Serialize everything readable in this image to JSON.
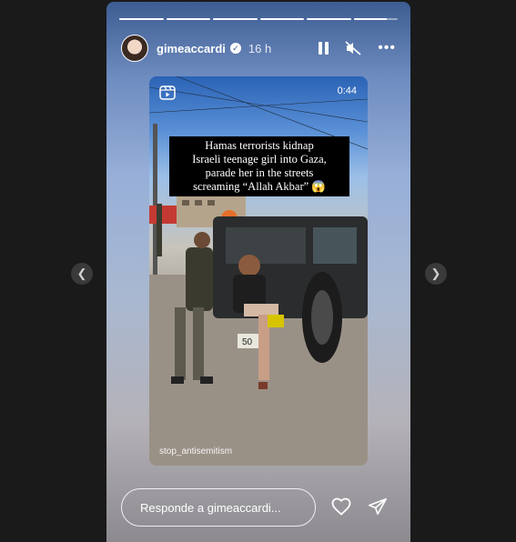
{
  "story": {
    "username": "gimeaccardi",
    "time": "16 h",
    "progress_segments": [
      1,
      1,
      1,
      1,
      1,
      0.75
    ]
  },
  "video": {
    "duration": "0:44",
    "caption_lines": [
      "Hamas terrorists kidnap",
      "Israeli teenage girl into Gaza,",
      "parade her in the streets",
      "screaming “Allah Akbar” 😱"
    ],
    "watermark": "stop_antisemitism",
    "plate_fragment": "50"
  },
  "reply": {
    "placeholder": "Responde a gimeaccardi..."
  },
  "icons": {
    "prev": "chevron-left-icon",
    "next": "chevron-right-icon",
    "verified": "verified-badge-icon",
    "pause": "pause-icon",
    "mute": "mute-icon",
    "more": "more-icon",
    "reel": "reel-icon",
    "like": "heart-icon",
    "share": "send-icon"
  },
  "colors": {
    "page_background": "#1a1a1a",
    "story_gradient_top": "#3d5c91",
    "text": "#ffffff"
  }
}
